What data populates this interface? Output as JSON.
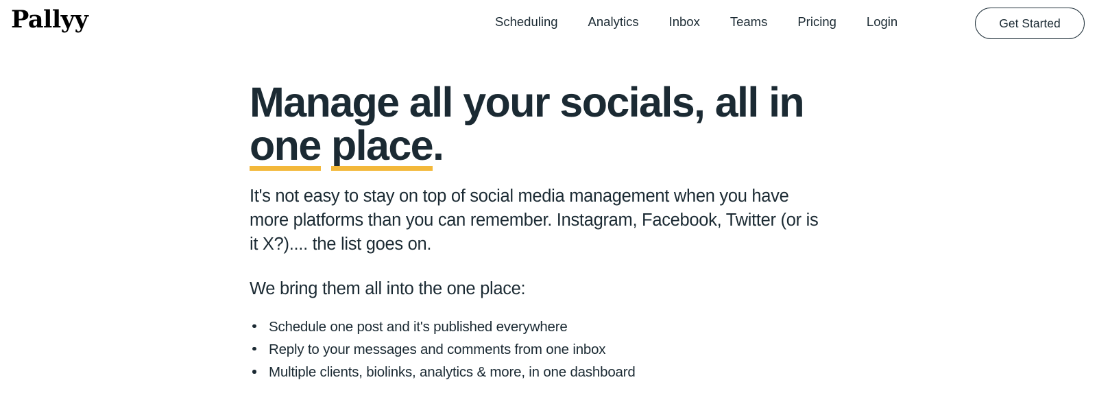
{
  "theme": {
    "background": "#ffffff",
    "text_dark": "#1b2a33",
    "accent_underline": "#f3b83a",
    "logo_color": "#000000",
    "button_border": "#20303a"
  },
  "header": {
    "logo_text": "Pallyy",
    "nav_items": [
      {
        "label": "Scheduling",
        "name": "nav-link-scheduling"
      },
      {
        "label": "Analytics",
        "name": "nav-link-analytics"
      },
      {
        "label": "Inbox",
        "name": "nav-link-inbox"
      },
      {
        "label": "Teams",
        "name": "nav-link-teams"
      },
      {
        "label": "Pricing",
        "name": "nav-link-pricing"
      },
      {
        "label": "Login",
        "name": "nav-link-login"
      }
    ],
    "cta_label": "Get Started"
  },
  "hero": {
    "title_part_1": "Manage all your socials, all in ",
    "title_highlight_1": "one",
    "title_space": " ",
    "title_highlight_2": "place",
    "title_part_end": ".",
    "paragraph": "It's not easy to stay on top of social media management when you have more platforms than you can remember. Instagram, Facebook, Twitter (or is it X?).... the list goes on.",
    "lead_in": "We bring them all into the one place:",
    "bullets": [
      "Schedule one post and it's published everywhere",
      "Reply to your messages and comments from one inbox",
      "Multiple clients, biolinks, analytics & more, in one dashboard"
    ]
  }
}
